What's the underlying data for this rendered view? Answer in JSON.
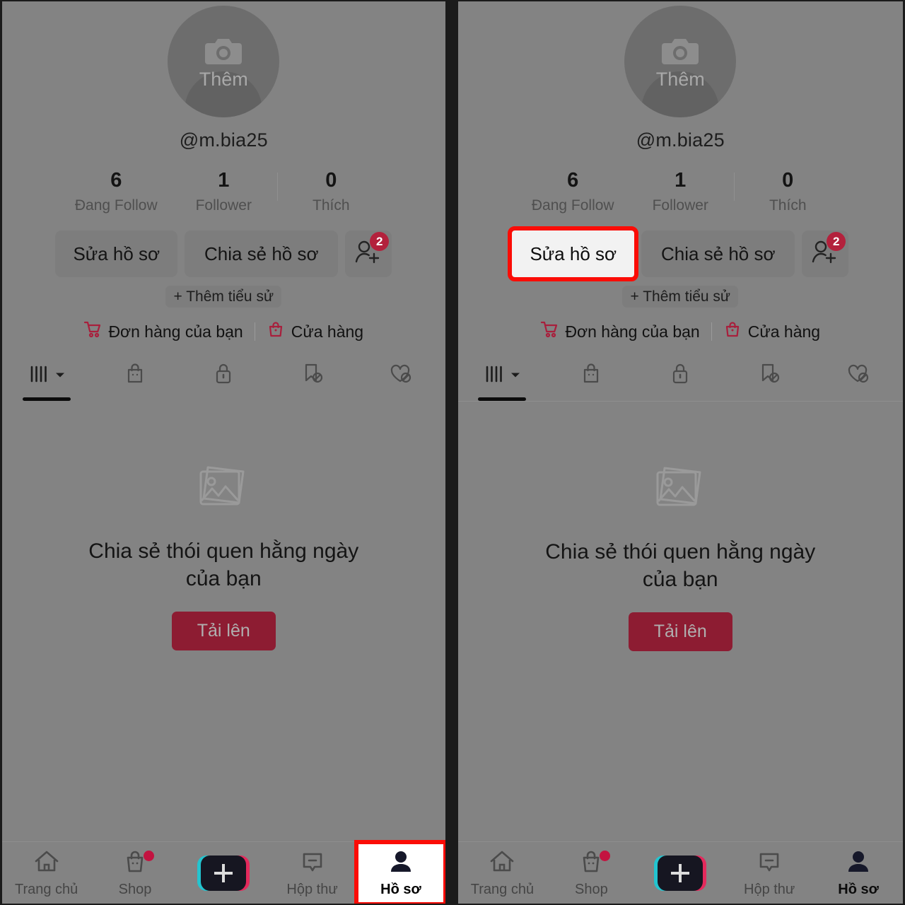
{
  "app": {
    "name": "TikTok Profile",
    "accent_red": "#8d1c32",
    "highlight_red": "#fb0c06",
    "panel_bg": "#838383",
    "badge_red": "#b3213c"
  },
  "profile": {
    "avatar_add_label": "Thêm",
    "avatar_icon": "camera-icon",
    "handle": "@m.bia25",
    "stats": [
      {
        "value": "6",
        "label": "Đang Follow"
      },
      {
        "value": "1",
        "label": "Follower"
      },
      {
        "value": "0",
        "label": "Thích"
      }
    ],
    "actions": {
      "edit_label": "Sửa hồ sơ",
      "share_label": "Chia sẻ hồ sơ",
      "add_friend_icon": "person-add-icon",
      "add_friend_badge": "2"
    },
    "bio_chip_label": "+ Thêm tiểu sử",
    "shop_links": [
      {
        "label": "Đơn hàng của bạn",
        "icon": "shopping-cart-icon"
      },
      {
        "label": "Cửa hàng",
        "icon": "shop-bag-icon"
      }
    ]
  },
  "content_tabs": [
    {
      "name": "grid-tab",
      "icon": "grid-icon",
      "active": true
    },
    {
      "name": "shop-tab",
      "icon": "shopping-bag-icon",
      "active": false
    },
    {
      "name": "private-tab",
      "icon": "lock-icon",
      "active": false
    },
    {
      "name": "saved-tab",
      "icon": "bookmark-off-icon",
      "active": false
    },
    {
      "name": "liked-tab",
      "icon": "heart-off-icon",
      "active": false
    }
  ],
  "empty_state": {
    "icon": "image-placeholder-icon",
    "title_line1": "Chia sẻ thói quen hằng ngày",
    "title_line2": "của bạn",
    "upload_label": "Tải lên"
  },
  "bottom_nav": [
    {
      "label": "Trang chủ",
      "icon": "home-icon",
      "active": false,
      "dot": false
    },
    {
      "label": "Shop",
      "icon": "shop-icon",
      "active": false,
      "dot": true
    },
    {
      "label": "",
      "icon": "create-icon",
      "active": false,
      "dot": false
    },
    {
      "label": "Hộp thư",
      "icon": "inbox-icon",
      "active": false,
      "dot": false
    },
    {
      "label": "Hồ sơ",
      "icon": "profile-icon",
      "active": true,
      "dot": false
    }
  ],
  "annotations": {
    "left_panel_highlight": "bottom-nav-profile",
    "right_panel_highlight": "edit-profile-button"
  }
}
